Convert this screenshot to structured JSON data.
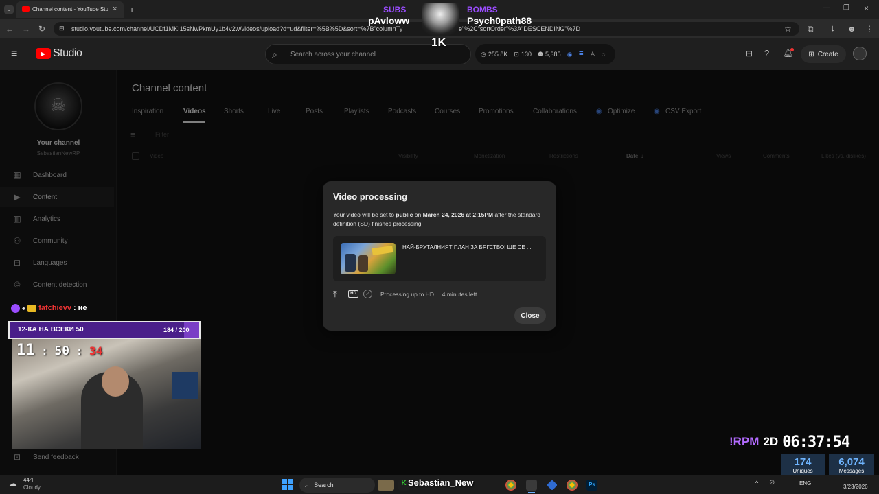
{
  "browser": {
    "tab_title": "Channel content - YouTube Stu",
    "url": "studio.youtube.com/channel/UCDf1MKI15sNwPkmUy1b4v2w/videos/upload?d=ud&filter=%5B%5D&sort=%7B\"columnTy",
    "url_tail": "e\"%2C\"sortOrder\"%3A\"DESCENDING\"%7D"
  },
  "overlay_top": {
    "subs_label": "SUBS",
    "subs_name": "pAvloww",
    "bombs_label": "BOMBS",
    "bombs_name": "Psych0path88",
    "count": "1K"
  },
  "header": {
    "logo_text": "Studio",
    "search_placeholder": "Search across your channel",
    "stat_views": "255.8K",
    "stat_comments": "130",
    "stat_subs": "5,385",
    "create_label": "Create"
  },
  "sidebar": {
    "channel_title": "Your channel",
    "channel_name": "SebastianNewRP",
    "items": [
      {
        "label": "Dashboard",
        "icon": "dashboard-icon"
      },
      {
        "label": "Content",
        "icon": "content-icon"
      },
      {
        "label": "Analytics",
        "icon": "analytics-icon"
      },
      {
        "label": "Community",
        "icon": "community-icon"
      },
      {
        "label": "Languages",
        "icon": "languages-icon"
      },
      {
        "label": "Content detection",
        "icon": "copyright-icon"
      }
    ],
    "feedback_label": "Send feedback"
  },
  "main": {
    "page_title": "Channel content",
    "tabs": [
      "Inspiration",
      "Videos",
      "Shorts",
      "Live",
      "Posts",
      "Playlists",
      "Podcasts",
      "Courses",
      "Promotions",
      "Collaborations",
      "Optimize",
      "CSV Export"
    ],
    "active_tab": "Videos",
    "filter_placeholder": "Filter",
    "columns": [
      "Video",
      "Visibility",
      "Monetization",
      "Restrictions",
      "Date",
      "Views",
      "Comments",
      "Likes (vs. dislikes)"
    ]
  },
  "dialog": {
    "title": "Video processing",
    "msg_part1": "Your video will be set to ",
    "msg_public": "public",
    "msg_part2": " on ",
    "msg_date": "March 24, 2026 at 2:15PM",
    "msg_part3": " after the standard definition (SD) finishes processing",
    "video_title": "НАЙ-БРУТАЛНИЯТ ПЛАН ЗА БЯГСТВО! ЩЕ СЕ ...",
    "status": "Processing up to HD ... 4 minutes left",
    "hd_label": "HD",
    "close_label": "Close"
  },
  "stream": {
    "chat_user": "fafchievv",
    "chat_text": ": не",
    "goal_label": "12-КА НА ВСЕКИ 50",
    "goal_count": "184 / 200",
    "goal_progress": 0.92,
    "timer_h": "11",
    "timer_m": "50",
    "timer_s": "34",
    "rpm_label": "!RPM",
    "rpm_value": "2D",
    "clock": "06:37:54",
    "uniques_value": "174",
    "uniques_label": "Uniques",
    "messages_value": "6,074",
    "messages_label": "Messages"
  },
  "taskbar": {
    "weather_temp": "44°F",
    "weather_desc": "Cloudy",
    "search_label": "Search",
    "overlay_name": "Sebastian_New",
    "lang": "ENG",
    "date": "3/23/2026"
  }
}
